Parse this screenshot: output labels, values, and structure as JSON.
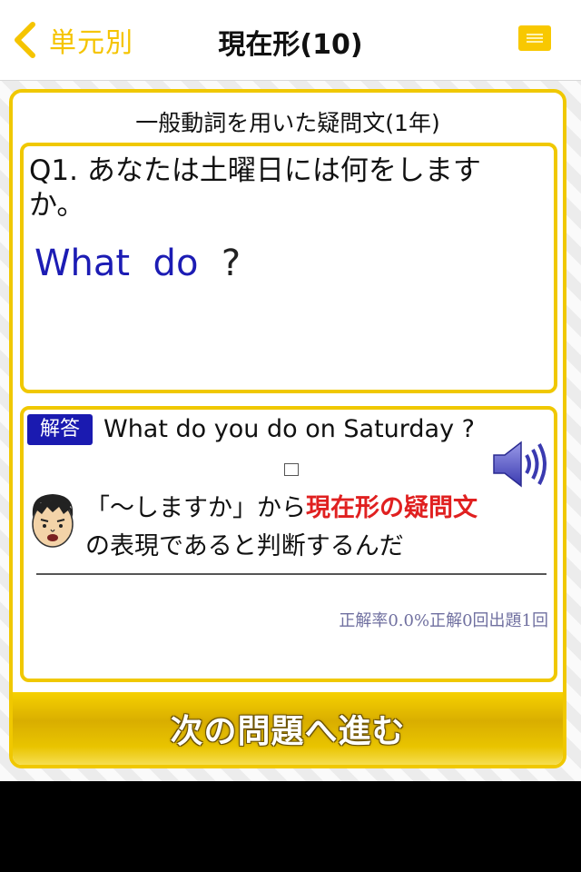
{
  "header": {
    "back_label": "単元別",
    "title": "現在形(10)"
  },
  "card": {
    "section_title": "一般動詞を用いた疑問文(1年)",
    "question": {
      "text": "Q1. あなたは土曜日には何をしますか。",
      "answer_words": [
        "What",
        "do"
      ],
      "answer_end": "?"
    },
    "answer": {
      "badge": "解答",
      "text": "What do you do on Saturday ?",
      "explanation_pre": "「〜しますか」から",
      "explanation_highlight": "現在形の疑問文",
      "explanation_post": "の表現であると判断するんだ",
      "stats": "正解率0.0%正解0回出題1回"
    },
    "next_button": "次の問題へ進む"
  },
  "colors": {
    "accent": "#f0c800",
    "answer_blue": "#1c1cb4",
    "highlight_red": "#e02020",
    "stats_gray": "#7070a0"
  },
  "icons": {
    "back": "chevron-left-icon",
    "menu": "menu-icon",
    "speaker": "speaker-icon",
    "avatar": "teacher-face-icon"
  }
}
